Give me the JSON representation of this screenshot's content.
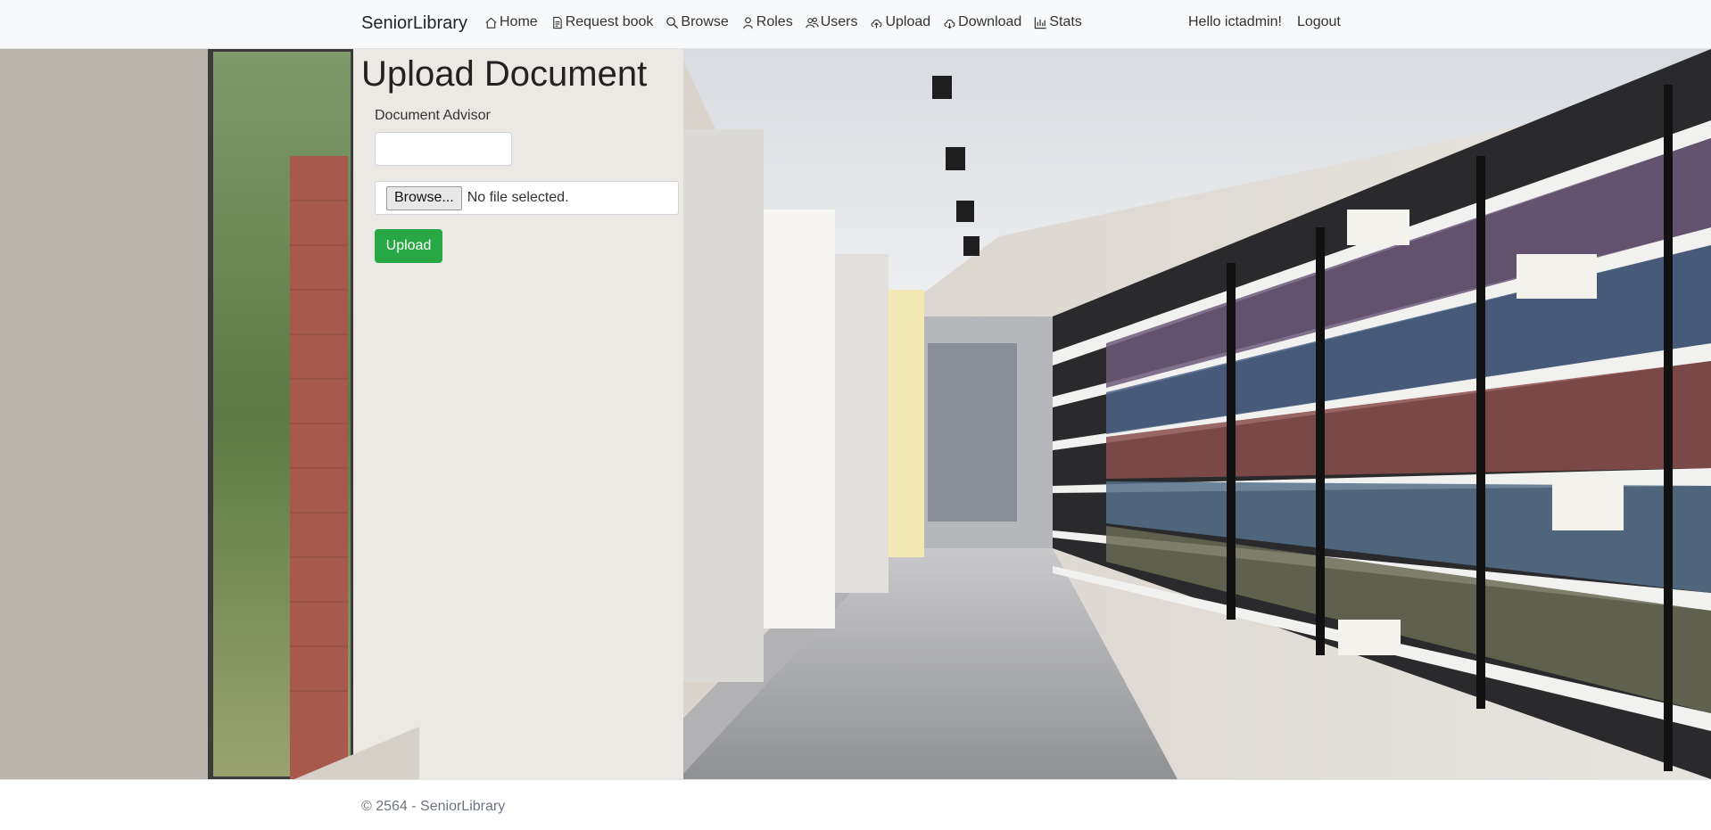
{
  "navbar": {
    "brand": "SeniorLibrary",
    "items": [
      {
        "label": "Home",
        "icon": "house-icon"
      },
      {
        "label": "Request book",
        "icon": "document-icon"
      },
      {
        "label": "Browse",
        "icon": "search-icon"
      },
      {
        "label": "Roles",
        "icon": "person-icon"
      },
      {
        "label": "Users",
        "icon": "people-icon"
      },
      {
        "label": "Upload",
        "icon": "cloud-upload-icon"
      },
      {
        "label": "Download",
        "icon": "cloud-download-icon"
      },
      {
        "label": "Stats",
        "icon": "bar-chart-icon"
      }
    ],
    "greeting": "Hello ictadmin!",
    "logout": "Logout"
  },
  "main": {
    "title": "Upload Document",
    "advisor_label": "Document Advisor",
    "advisor_value": "",
    "browse_label": "Browse...",
    "file_status": "No file selected.",
    "upload_label": "Upload"
  },
  "footer": {
    "text": "© 2564 - SeniorLibrary"
  },
  "colors": {
    "navbar_bg": "#f8f9fa",
    "upload_button": "#28a745"
  }
}
